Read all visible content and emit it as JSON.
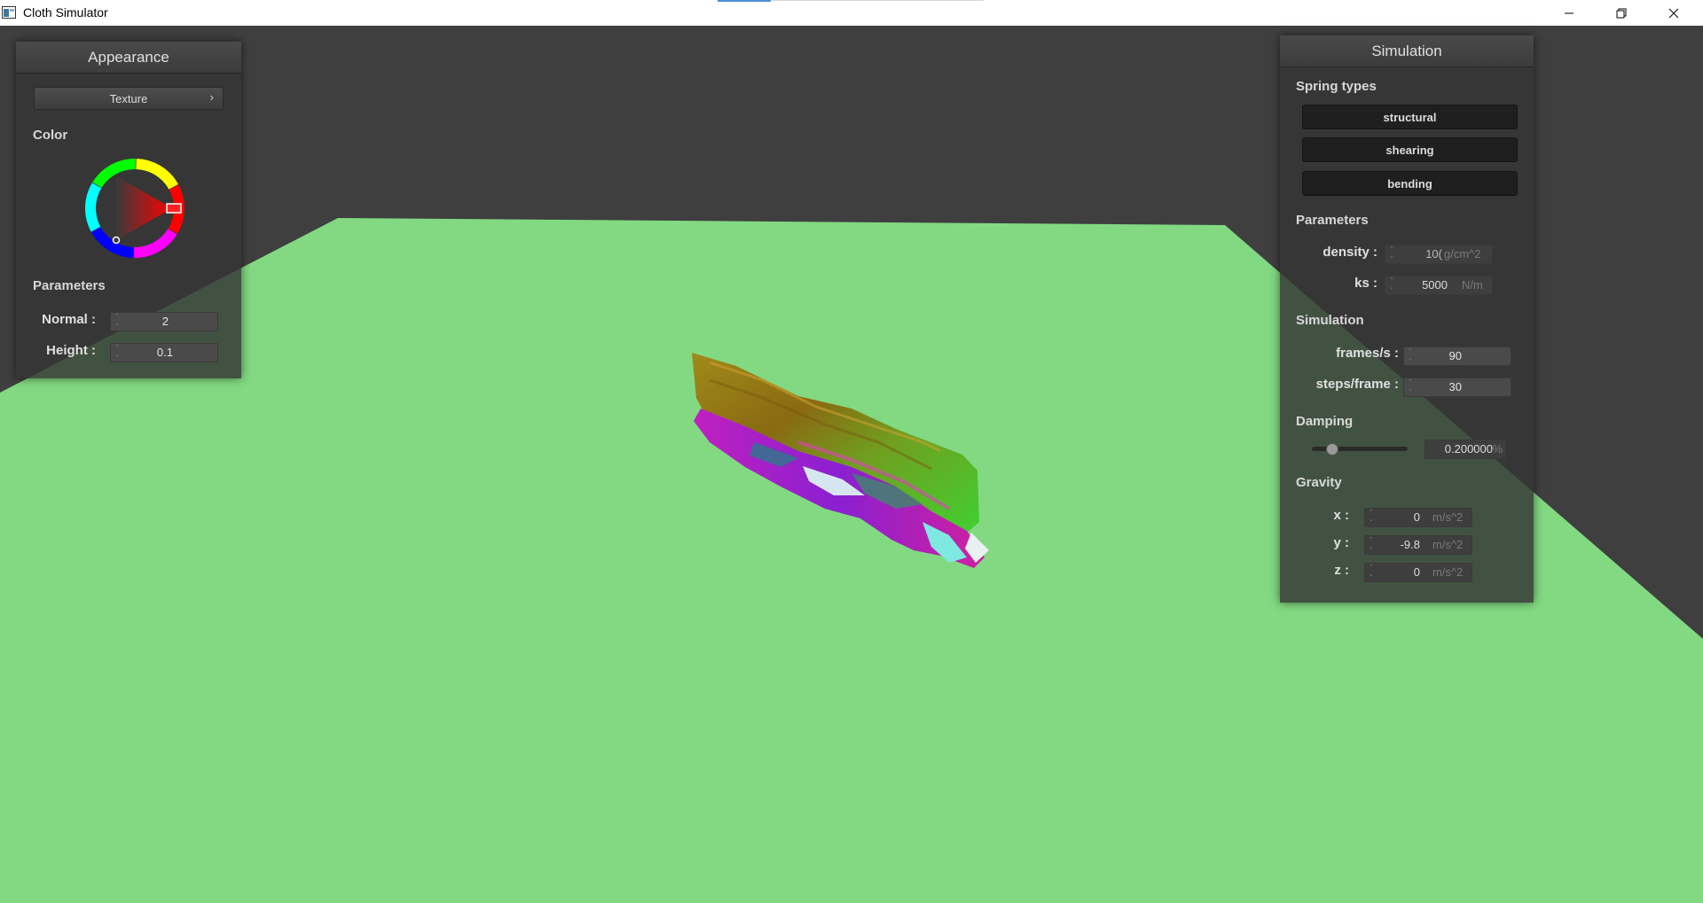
{
  "window": {
    "title": "Cloth Simulator",
    "controls": {
      "minimize_icon": "minimize-icon",
      "maximize_icon": "restore-icon",
      "close_icon": "close-icon"
    }
  },
  "scene": {
    "background_color": "#3f3f3f",
    "floor_color": "#82d982"
  },
  "appearance": {
    "header": "Appearance",
    "shader_button": "Texture",
    "shader_chevron": "›",
    "color_label": "Color",
    "color_value": "#ff0000",
    "parameters_label": "Parameters",
    "normal_label": "Normal :",
    "normal_value": "2",
    "height_label": "Height :",
    "height_value": "0.1"
  },
  "simulation": {
    "header": "Simulation",
    "spring_types_label": "Spring types",
    "spring_buttons": [
      "structural",
      "shearing",
      "bending"
    ],
    "parameters_label": "Parameters",
    "density_label": "density :",
    "density_value": "10(",
    "density_unit": "g/cm^2",
    "ks_label": "ks :",
    "ks_value": "5000",
    "ks_unit": "N/m",
    "simulation_label": "Simulation",
    "fps_label": "frames/s :",
    "fps_value": "90",
    "steps_label": "steps/frame :",
    "steps_value": "30",
    "damping_label": "Damping",
    "damping_value": "0.200000",
    "damping_unit": "%",
    "damping_slider_fraction": 0.2,
    "gravity_label": "Gravity",
    "gx_label": "x :",
    "gx_value": "0",
    "gy_label": "y :",
    "gy_value": "-9.8",
    "gz_label": "z :",
    "gz_value": "0",
    "gravity_unit": "m/s^2"
  }
}
